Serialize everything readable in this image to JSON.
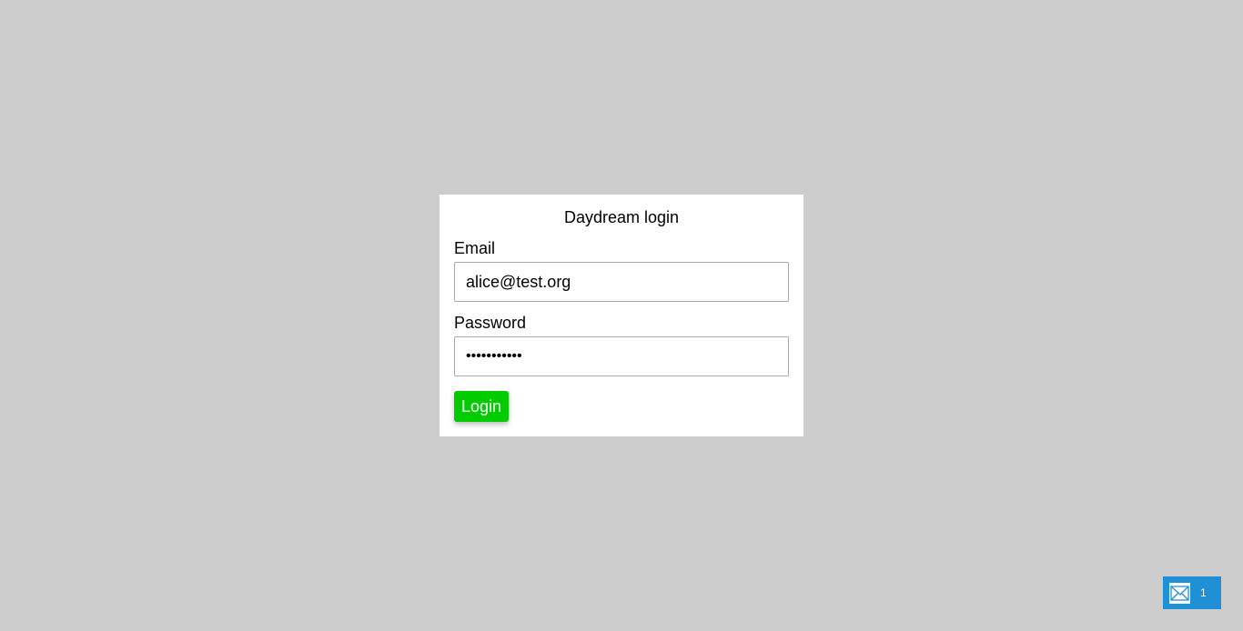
{
  "login": {
    "title": "Daydream login",
    "email_label": "Email",
    "email_value": "alice@test.org",
    "password_label": "Password",
    "password_value": "•••••••••••",
    "button_label": "Login"
  },
  "badge": {
    "icon": "mail-icon",
    "count": "1"
  },
  "colors": {
    "background": "#cdcdcd",
    "card": "#ffffff",
    "button": "#00cc00",
    "badge": "#1f8fd6"
  }
}
